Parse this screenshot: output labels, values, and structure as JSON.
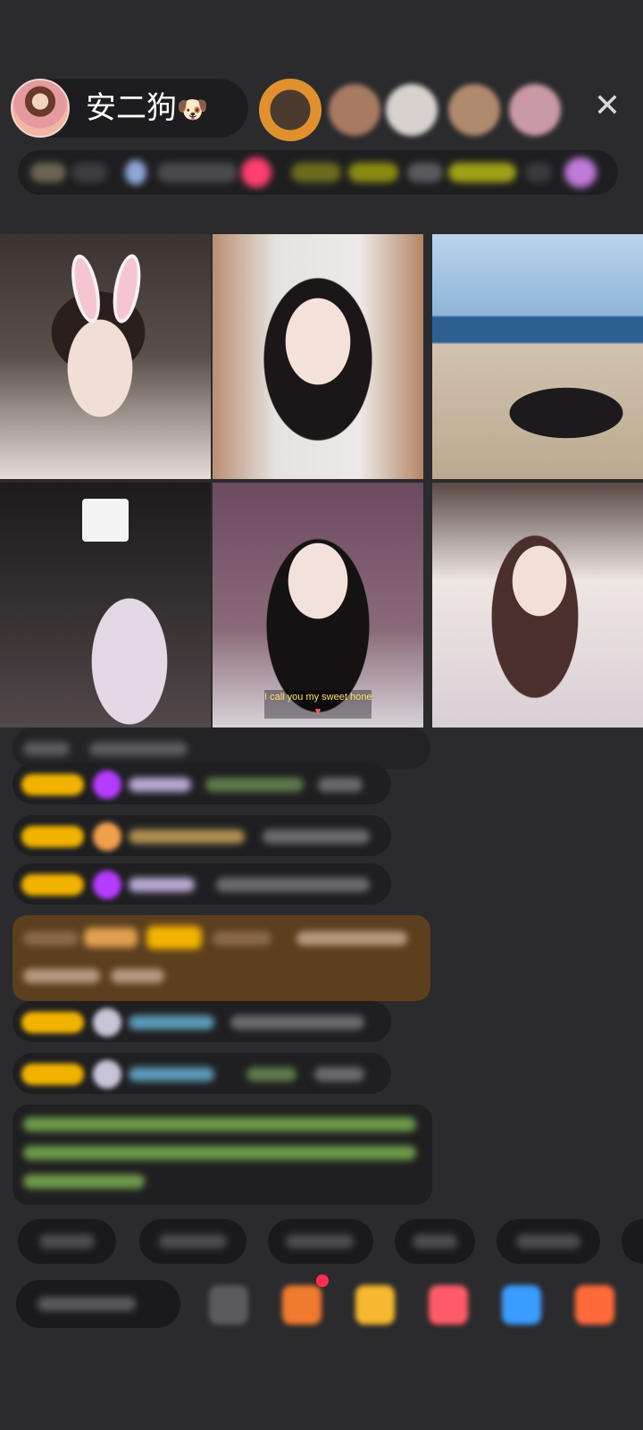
{
  "header": {
    "host_name": "安二狗",
    "host_emoji": "🐶",
    "close_glyph": "✕"
  },
  "viewer_avatars": [
    {
      "color": "#8a5a3a"
    },
    {
      "color": "#a87a62"
    },
    {
      "color": "#d8d2ce"
    },
    {
      "color": "#b08a6e"
    },
    {
      "color": "#c99aa6"
    }
  ],
  "info_strip": {
    "segments": [
      {
        "color": "#6b6453"
      },
      {
        "color": "#3d3d3f"
      },
      {
        "color": "#8fa8d8"
      },
      {
        "color": "#4a4a4c"
      },
      {
        "color": "#ff3e72"
      },
      {
        "color": "#6b6b1e"
      },
      {
        "color": "#8a8a12"
      },
      {
        "color": "#5a5a5c"
      },
      {
        "color": "#a0a016"
      },
      {
        "color": "#3a3a3c"
      },
      {
        "color": "#c07ad8"
      }
    ]
  },
  "video_tiles": [
    {
      "id": "1"
    },
    {
      "id": "2"
    },
    {
      "id": "3"
    },
    {
      "id": "4"
    },
    {
      "id": "5",
      "caption_top": "I call you my sweet honey",
      "caption_bottom": "♥"
    },
    {
      "id": "6"
    }
  ],
  "chat": {
    "rows": [
      {
        "badge_color": "#f2b300",
        "icon_color": "#b43cff"
      },
      {
        "badge_color": "#f2b300",
        "icon_color": "#f0a04a"
      },
      {
        "badge_color": "#f2b300",
        "icon_color": "#b43cff"
      },
      {
        "badge_color": "#f2b300",
        "icon_color": "#c7c4d8"
      },
      {
        "badge_color": "#f2b300",
        "icon_color": "#c7c4d8"
      }
    ],
    "name_colors": [
      "#b7a8d4",
      "#b09050",
      "#b7a8d4",
      "#5b9ab8",
      "#5b9ab8"
    ],
    "system_message_color": "#8bbf5a",
    "gift_row_color": "#5c3f1e"
  },
  "bottom_bar": {
    "icons": [
      {
        "name": "emoji-icon",
        "color": "#5a5a5c"
      },
      {
        "name": "gift-box-icon",
        "color": "#f07a2e"
      },
      {
        "name": "treasure-icon",
        "color": "#f5b82e"
      },
      {
        "name": "red-packet-icon",
        "color": "#ff5a6a"
      },
      {
        "name": "chat-bubble-icon",
        "color": "#3a9cff"
      },
      {
        "name": "grid-app-icon",
        "color": "#ff6a3a"
      }
    ]
  }
}
